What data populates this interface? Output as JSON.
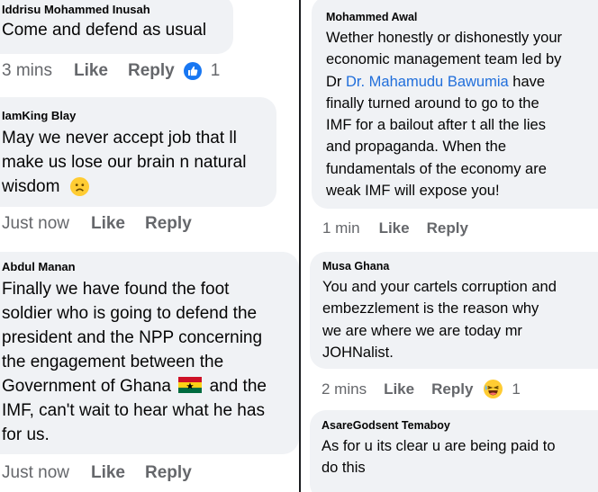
{
  "left_column": {
    "comments": [
      {
        "author": "Iddrisu Mohammed Inusah",
        "lines": [
          "Come and defend as usual"
        ],
        "time": "3 mins",
        "like_label": "Like",
        "reply_label": "Reply",
        "reaction": "like-icon",
        "reaction_count": "1"
      },
      {
        "author": "IamKing Blay",
        "lines": [
          "May we never accept job that ll",
          "make us lose our brain n natural",
          "wisdom"
        ],
        "emoji": "frowning-face-emoji",
        "time": "Just now",
        "like_label": "Like",
        "reply_label": "Reply"
      },
      {
        "author": "Abdul Manan",
        "lines": [
          "Finally we have found the foot",
          "soldier who is going to defend  the",
          "president and the NPP concerning",
          "the engagement between the",
          "Government of Ghana",
          "and the",
          "IMF, can't wait to hear what he has",
          "for us."
        ],
        "flag": "ghana-flag-emoji",
        "time": "Just now",
        "like_label": "Like",
        "reply_label": "Reply"
      }
    ]
  },
  "right_column": {
    "comments": [
      {
        "author": "Mohammed Awal",
        "lines": [
          "Wether honestly or dishonestly your",
          "economic management team led by",
          "Dr",
          "Dr. Mahamudu Bawumia",
          "have",
          "finally turned around to go to the",
          "IMF for a bailout after t all the lies",
          "and propaganda. When the",
          "fundamentals of the economy are",
          "weak IMF will expose you!"
        ],
        "time": "1 min",
        "like_label": "Like",
        "reply_label": "Reply"
      },
      {
        "author": "Musa Ghana",
        "lines": [
          "You and your cartels corruption and",
          "embezzlement is the reason why",
          "we are where we are today mr",
          "JOHNalist."
        ],
        "time": "2 mins",
        "like_label": "Like",
        "reply_label": "Reply",
        "reaction": "laughing-face-icon",
        "reaction_count": "1"
      },
      {
        "author": "AsareGodsent Temaboy",
        "lines": [
          "As for u its clear u are being paid to",
          "do this"
        ]
      }
    ]
  },
  "colors": {
    "bubble": "#f0f2f5",
    "link": "#216fdb",
    "meta": "#65676b",
    "like_blue": "#1877f2",
    "divider": "#1c1e21"
  }
}
